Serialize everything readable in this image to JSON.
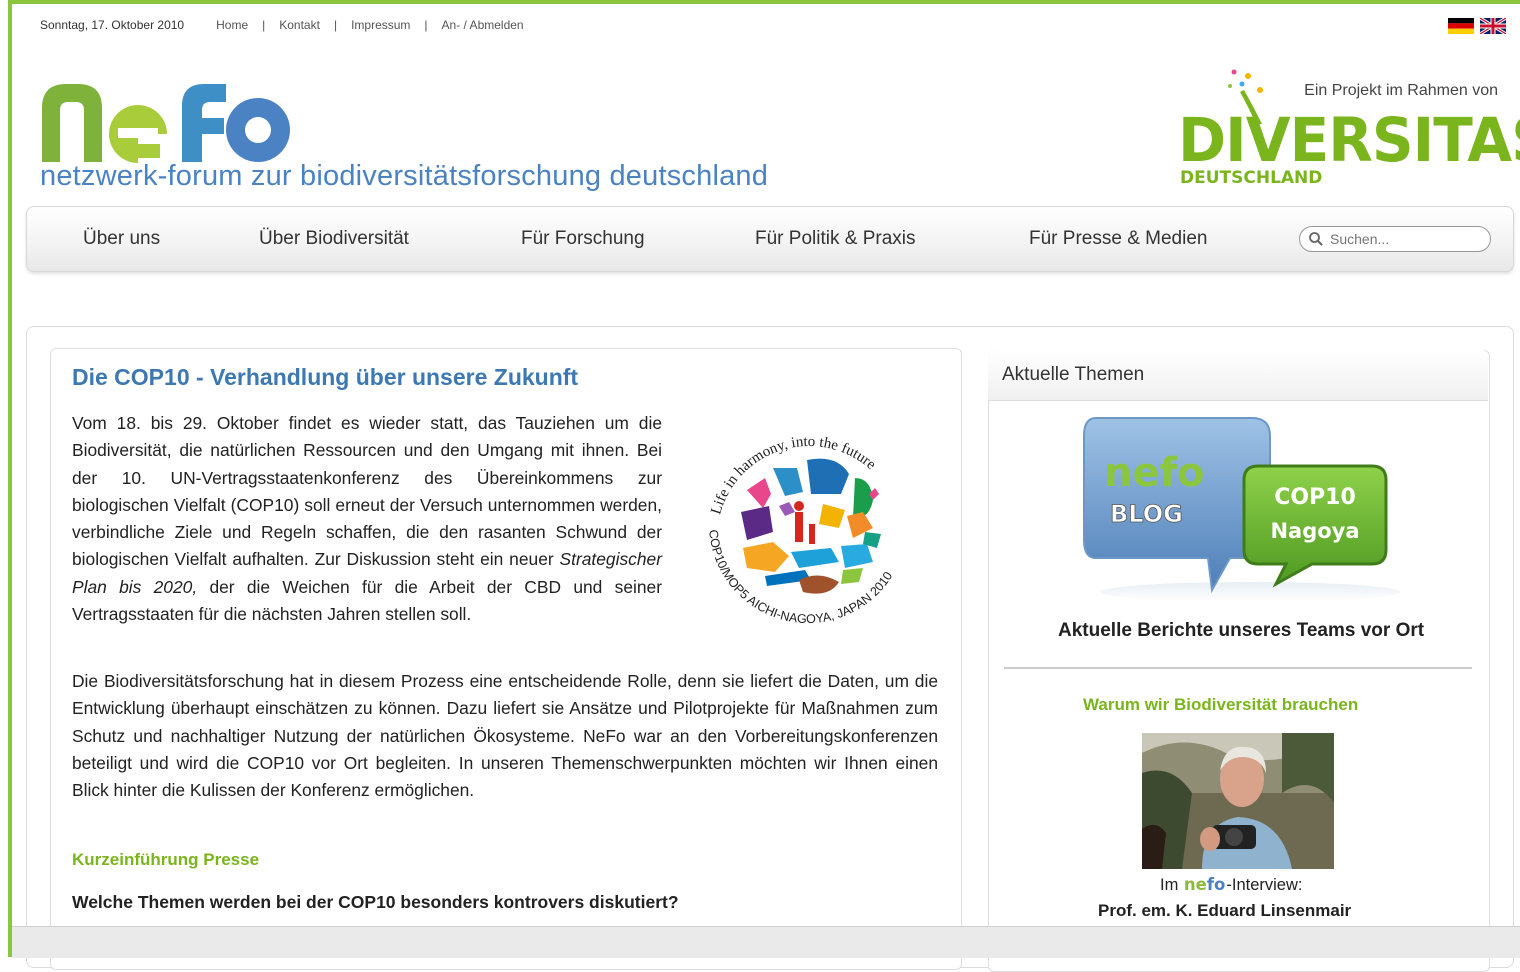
{
  "topbar": {
    "date": "Sonntag, 17. Oktober 2010",
    "links": [
      "Home",
      "Kontakt",
      "Impressum",
      "An- / Abmelden"
    ]
  },
  "logo": {
    "text": "nefo",
    "tagline": "netzwerk-forum zur biodiversitätsforschung deutschland"
  },
  "partner": {
    "subtitle": "Ein Projekt im Rahmen von",
    "name": "DIVERSITAS",
    "country": "DEUTSCHLAND"
  },
  "nav": {
    "items": [
      "Über uns",
      "Über Biodiversität",
      "Für Forschung",
      "Für Politik & Praxis",
      "Für Presse & Medien"
    ],
    "search_placeholder": "Suchen..."
  },
  "article": {
    "title": "Die COP10 - Verhandlung über unsere Zukunft",
    "para1_a": "Vom 18. bis 29. Oktober findet es wieder statt, das Tauziehen um die Biodiversität, die natürlichen Ressourcen und den Umgang mit ihnen. Bei der 10. UN-Vertragsstaatenkonferenz des Übereinkommens zur biologischen Vielfalt (COP10) soll erneut der Versuch unternommen werden, verbindliche Ziele und Regeln schaffen, die den rasanten Schwund der biologischen Vielfalt aufhalten. Zur Diskussion steht ein neuer ",
    "para1_em": "Strategischer Plan bis 2020,",
    "para1_b": " der die Weichen für die Arbeit der CBD und seiner Vertragsstaaten für die nächsten Jahren stellen soll.",
    "para2": "Die Biodiversitätsforschung hat in diesem Prozess eine entscheidende Rolle, denn sie liefert die Daten, um die Entwicklung überhaupt einschätzen zu können. Dazu liefert sie Ansätze und Pilotprojekte für Maßnahmen zum Schutz und nachhaltiger Nutzung der natürlichen Ökosysteme. NeFo war an den Vorbereitungskonferenzen beteiligt und wird die COP10 vor Ort begleiten. In unseren Themenschwerpunkten möchten wir Ihnen einen Blick hinter die Kulissen der Konferenz ermöglichen.",
    "link": "Kurzeinführung Presse",
    "question": "Welche Themen werden bei der COP10 besonders kontrovers diskutiert?",
    "cop_logo": {
      "top_text": "Life in harmony, into the future",
      "bottom_text": "COP10/MOP5 AICHI-NAGOYA, JAPAN 2010"
    }
  },
  "sidebar": {
    "title": "Aktuelle Themen",
    "blog_graphic": {
      "left_bubble": [
        "nefo",
        "BLOG"
      ],
      "right_bubble": [
        "COP10",
        "Nagoya"
      ]
    },
    "blog_caption": "Aktuelle Berichte unseres Teams vor Ort",
    "link": "Warum wir Biodiversität brauchen",
    "interview_prefix": "Im ",
    "interview_logo": "nefo",
    "interview_suffix": "-Interview:",
    "person": "Prof. em. K. Eduard Linsenmair"
  },
  "colors": {
    "green": "#8cc63f",
    "nefo_green": "#8dba3a",
    "nefo_blue": "#4a82c3",
    "title_blue": "#3d78b2",
    "link_green": "#7ab51d"
  }
}
